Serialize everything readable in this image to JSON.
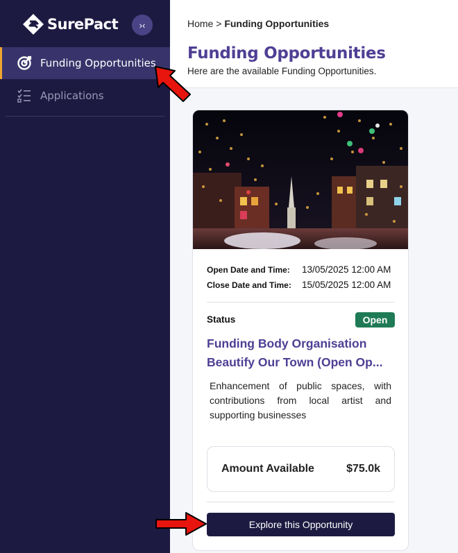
{
  "brand": {
    "name": "SurePact"
  },
  "sidebar": {
    "collapse_glyph": "›‹",
    "items": [
      {
        "label": "Funding Opportunities",
        "icon": "target-icon",
        "active": true
      },
      {
        "label": "Applications",
        "icon": "checklist-icon",
        "active": false
      }
    ]
  },
  "breadcrumb": {
    "home": "Home",
    "separator": ">",
    "current": "Funding Opportunities"
  },
  "page": {
    "title": "Funding Opportunities",
    "subtitle": "Here are the available Funding Opportunities."
  },
  "card": {
    "open_label": "Open Date and Time:",
    "open_value": "13/05/2025 12:00 AM",
    "close_label": "Close Date and Time:",
    "close_value": "15/05/2025 12:00 AM",
    "status_label": "Status",
    "status_value": "Open",
    "title_line1": "Funding Body Organisation",
    "title_line2": "Beautify Our Town (Open Op...",
    "description": "Enhancement of public spaces, with contributions from local artist and supporting businesses",
    "amount_label": "Amount Available",
    "amount_value": "$75.0k",
    "button_label": "Explore this Opportunity"
  },
  "colors": {
    "sidebar_bg": "#1d1a42",
    "accent_purple": "#4f3f94",
    "status_green": "#1f7a56",
    "active_marker": "#f0a530",
    "annotation_red": "#e8150e"
  }
}
